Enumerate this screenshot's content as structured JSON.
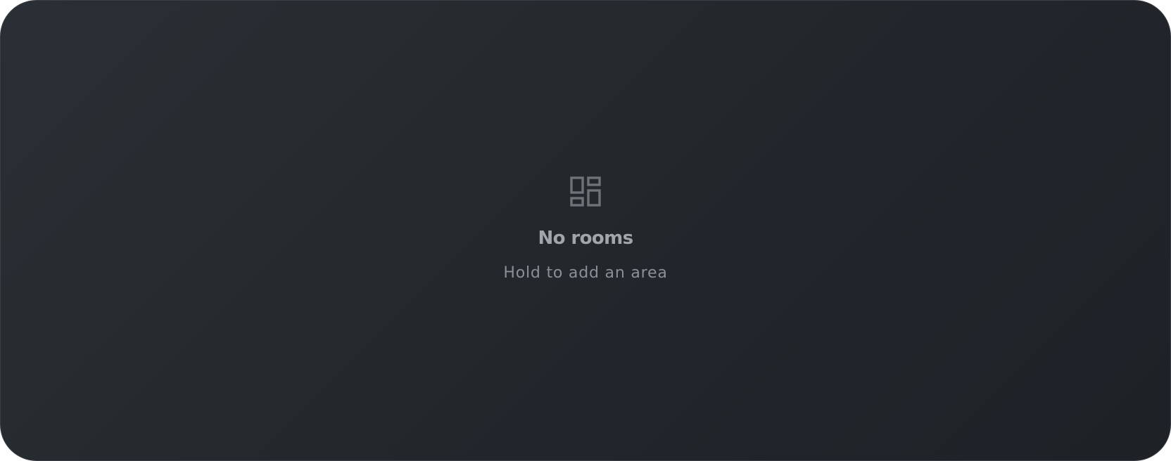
{
  "empty_state": {
    "icon": "dashboard-icon",
    "title": "No rooms",
    "subtitle": "Hold to add an area"
  },
  "colors": {
    "background_start": "#2a2f36",
    "background_end": "#1e2126",
    "icon": "#6f7378",
    "title": "#a2a6ab",
    "subtitle": "#8b9096"
  }
}
